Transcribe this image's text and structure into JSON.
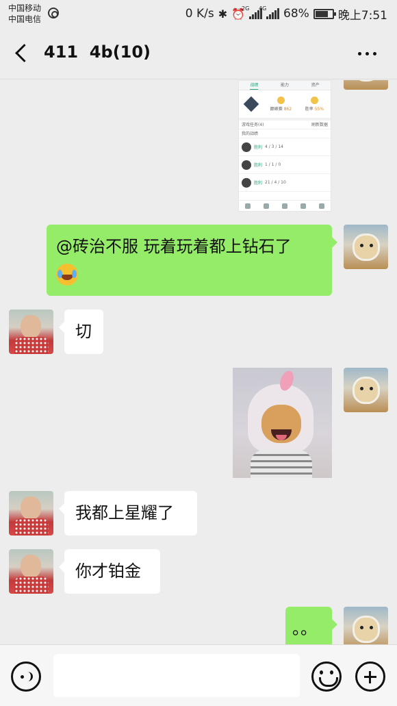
{
  "status_bar": {
    "carrier_1": "中国移动",
    "carrier_2": "中国电信",
    "net_speed": "0 K/s",
    "net_2g": "2G",
    "net_4g": "4G",
    "battery_percent": "68%",
    "time": "晚上7:51"
  },
  "header": {
    "title": "411  4b(10)"
  },
  "shot": {
    "tab_1": "战绩",
    "tab_2": "能力",
    "tab_3": "资产",
    "stat_1_label": "巅峰赛",
    "stat_1_value": "862",
    "stat_2_label": "胜率",
    "stat_2_value": "55%",
    "section_1": "游戏任务(4)",
    "section_1_right": "刷新数据",
    "section_2": "我的战绩",
    "match_1_result": "胜利",
    "match_1_kda": "4 / 3 / 14",
    "match_2_result": "胜利",
    "match_2_kda": "1 / 1 / 0",
    "match_3_result": "胜利",
    "match_3_kda": "21 / 4 / 10"
  },
  "messages": [
    {
      "sender": "me",
      "text": "@砖治不服  玩着玩着都上钻石了"
    },
    {
      "sender": "other",
      "text": "切"
    },
    {
      "sender": "other",
      "text": "我都上星耀了"
    },
    {
      "sender": "other",
      "text": "你才铂金"
    },
    {
      "sender": "me",
      "text": "。。"
    }
  ],
  "input": {
    "placeholder": ""
  }
}
